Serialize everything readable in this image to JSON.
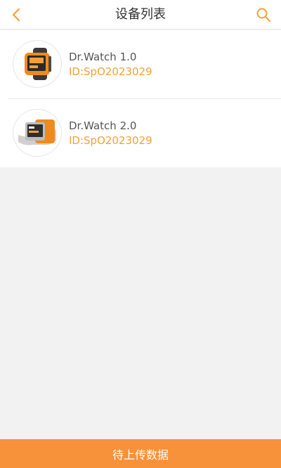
{
  "header": {
    "title": "设备列表",
    "back_icon": "chevron-left-icon",
    "search_icon": "search-icon"
  },
  "devices": [
    {
      "name": "Dr.Watch 1.0",
      "id": "ID:SpO2023029",
      "image": "orange-watch-image"
    },
    {
      "name": "Dr.Watch 2.0",
      "id": "ID:SpO2023029",
      "image": "silver-orange-watch-image"
    }
  ],
  "footer": {
    "upload_label": "待上传数据"
  },
  "colors": {
    "accent": "#f5a037",
    "button": "#f7913a",
    "background": "#f2f2f2"
  }
}
